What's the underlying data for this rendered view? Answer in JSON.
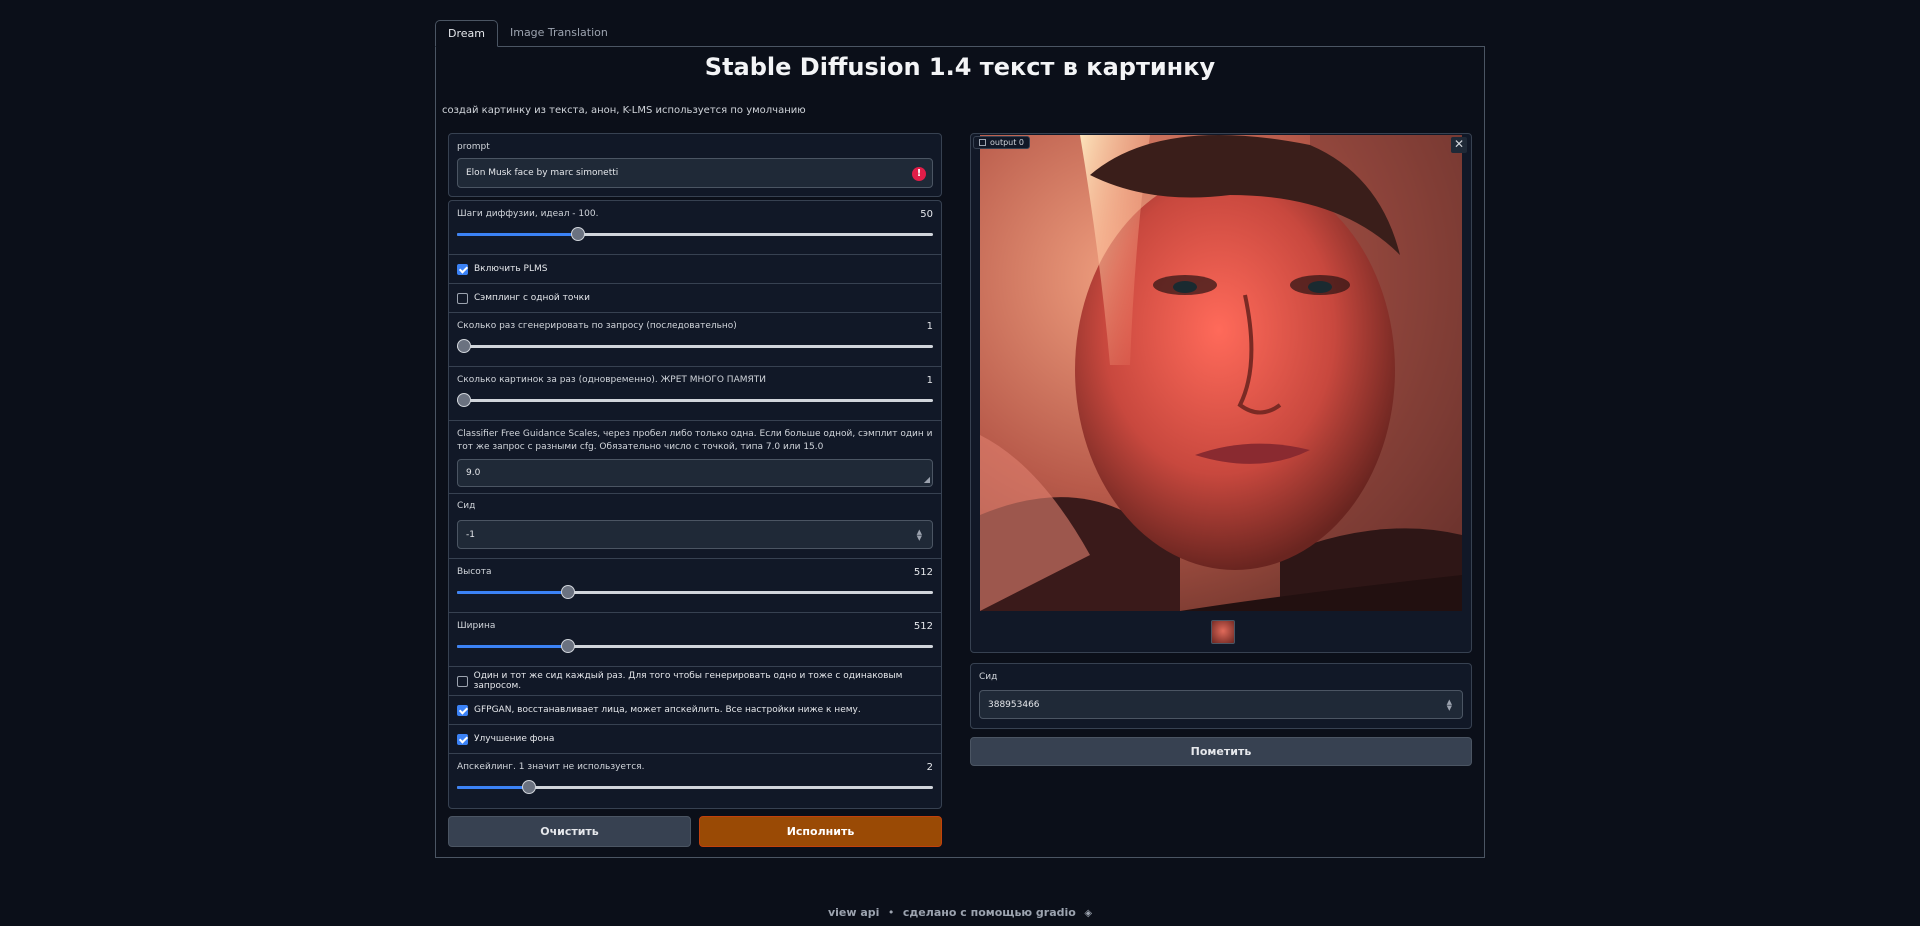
{
  "tabs": [
    "Dream",
    "Image Translation"
  ],
  "title": "Stable Diffusion 1.4 текст в картинку",
  "description": "создай картинку из текста, анон, K-LMS используется по умолчанию",
  "prompt": {
    "label": "prompt",
    "value": "Elon Musk face by marc simonetti"
  },
  "steps": {
    "label": "Шаги диффузии, идеал - 100.",
    "value": "50",
    "fraction": 0.255
  },
  "plms": {
    "label": "Включить PLMS",
    "checked": true
  },
  "fixed_code": {
    "label": "Сэмплинг с одной точки",
    "checked": false
  },
  "n_iter": {
    "label": "Сколько раз сгенерировать по запросу (последовательно)",
    "value": "1",
    "fraction": 0.0
  },
  "n_samples": {
    "label": "Сколько картинок за раз (одновременно). ЖРЕТ МНОГО ПАМЯТИ",
    "value": "1",
    "fraction": 0.0
  },
  "cfg": {
    "label": "Classifier Free Guidance Scales, через пробел либо только одна. Если больше одной, сэмплит один и тот же запрос с разными cfg. Обязательно число с точкой, типа 7.0 или 15.0",
    "value": "9.0"
  },
  "seed": {
    "label": "Сид",
    "value": "-1"
  },
  "height": {
    "label": "Высота",
    "value": "512",
    "fraction": 0.233
  },
  "width": {
    "label": "Ширина",
    "value": "512",
    "fraction": 0.233
  },
  "same_seed": {
    "label": "Один и тот же сид каждый раз. Для того чтобы генерировать одно и тоже с одинаковым запросом.",
    "checked": false
  },
  "gfpgan": {
    "label": "GFPGAN, восстанавливает лица, может апскейлить. Все настройки ниже к нему.",
    "checked": true
  },
  "bg_enhance": {
    "label": "Улучшение фона",
    "checked": true
  },
  "upscale": {
    "label": "Апскейлинг. 1 значит не используется.",
    "value": "2",
    "fraction": 0.152
  },
  "buttons": {
    "clear": "Очистить",
    "run": "Исполнить",
    "flag": "Пометить"
  },
  "output": {
    "label": "output 0"
  },
  "output_seed": {
    "label": "Сид",
    "value": "388953466"
  },
  "footer": {
    "api": "view api",
    "sep": "•",
    "made": "сделано с помощью gradio"
  },
  "colors": {
    "accent": "#3b82f6",
    "primary_button": "#9a4a05",
    "error": "#e11d48"
  }
}
